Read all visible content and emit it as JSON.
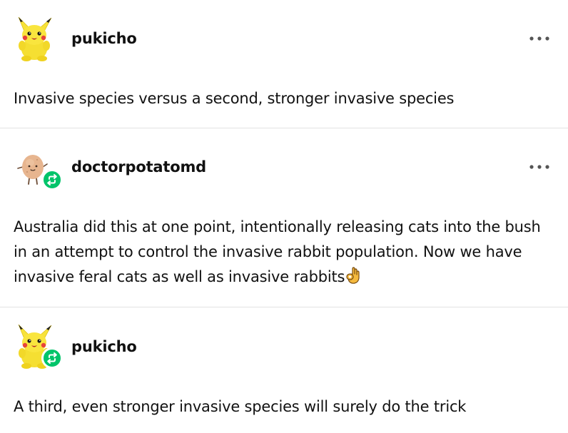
{
  "posts": [
    {
      "username": "pukicho",
      "avatar": "pikachu-plush-icon",
      "reblog": false,
      "text": "Invasive species versus a second, stronger invasive species"
    },
    {
      "username": "doctorpotatomd",
      "avatar": "potato-icon",
      "reblog": true,
      "text": "Australia did this at one point, intentionally releasing cats into the bush in an attempt to control the invasive rabbit population. Now we have invasive feral cats as well as invasive rabbits",
      "emoji": "ok-hand-emoji"
    },
    {
      "username": "pukicho",
      "avatar": "pikachu-plush-icon",
      "reblog": true,
      "text": "A third, even stronger invasive species will surely do the trick"
    }
  ],
  "more_icon": "more-options-icon",
  "reblog_icon": "reblog-icon",
  "colors": {
    "reblog_badge": "#00c46a",
    "divider": "#e2e2e2",
    "text": "#111111",
    "muted_icon": "#555555"
  }
}
